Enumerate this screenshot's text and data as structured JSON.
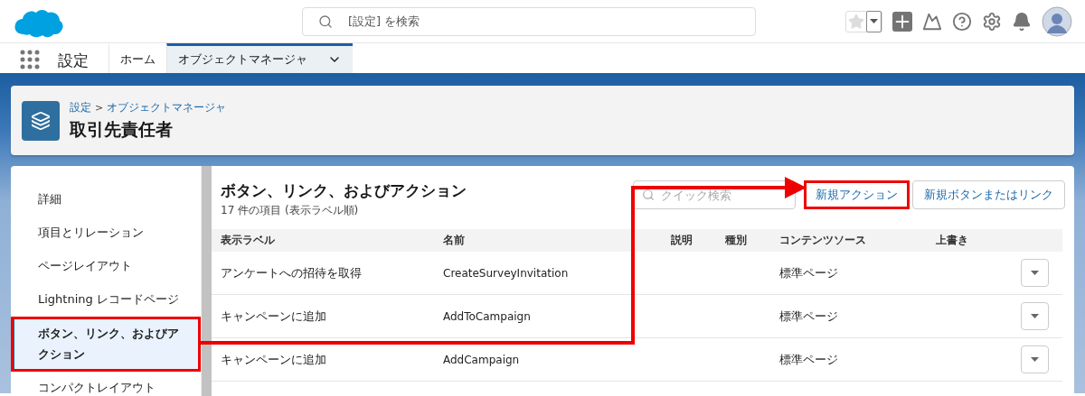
{
  "header": {
    "search": {
      "placeholder": "[設定] を検索"
    }
  },
  "nav": {
    "app_name": "設定",
    "tabs": [
      {
        "label": "ホーム",
        "selected": false
      },
      {
        "label": "オブジェクトマネージャ",
        "selected": true
      }
    ]
  },
  "object_header": {
    "breadcrumb": [
      "設定",
      "オブジェクトマネージャ"
    ],
    "separator": ">",
    "title": "取引先責任者"
  },
  "sidebar": {
    "items": [
      {
        "label": "詳細",
        "selected": false,
        "highlighted": false
      },
      {
        "label": "項目とリレーション",
        "selected": false,
        "highlighted": false
      },
      {
        "label": "ページレイアウト",
        "selected": false,
        "highlighted": false
      },
      {
        "label": "Lightning レコードページ",
        "selected": false,
        "highlighted": false
      },
      {
        "label": "ボタン、リンク、およびアクション",
        "selected": true,
        "highlighted": true
      },
      {
        "label": "コンパクトレイアウト",
        "selected": false,
        "highlighted": false
      }
    ]
  },
  "content": {
    "title": "ボタン、リンク、およびアクション",
    "subtitle": "17 件の項目 (表示ラベル順)",
    "quick_search": {
      "placeholder": "クイック検索"
    },
    "buttons": [
      {
        "label": "新規アクション",
        "highlighted": true
      },
      {
        "label": "新規ボタンまたはリンク",
        "highlighted": false
      }
    ],
    "table": {
      "columns": [
        "表示ラベル",
        "名前",
        "説明",
        "種別",
        "コンテンツソース",
        "上書き"
      ],
      "rows": [
        {
          "label": "アンケートへの招待を取得",
          "name": "CreateSurveyInvitation",
          "content_source": "標準ページ"
        },
        {
          "label": "キャンペーンに追加",
          "name": "AddToCampaign",
          "content_source": "標準ページ"
        },
        {
          "label": "キャンペーンに追加",
          "name": "AddCampaign",
          "content_source": "標準ページ"
        }
      ]
    }
  }
}
